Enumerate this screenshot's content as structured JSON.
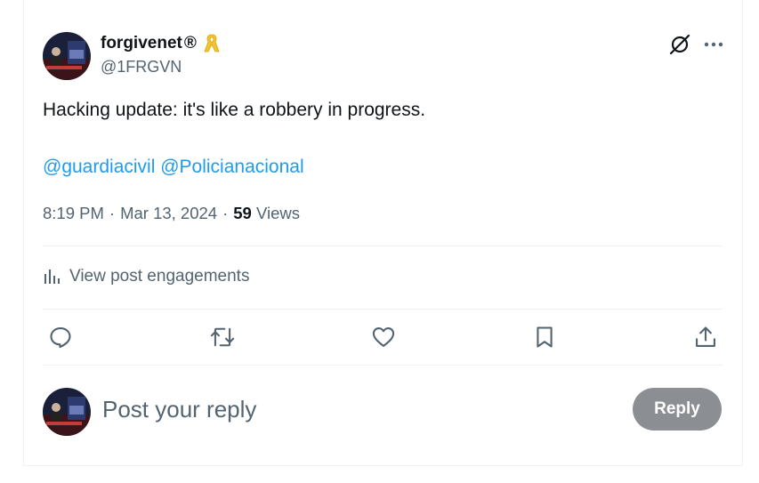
{
  "author": {
    "display_name": "forgivenet",
    "registered_mark": "®",
    "badge_icon": "yellow-ribbon-icon",
    "handle": "@1FRGVN"
  },
  "tweet": {
    "text": "Hacking update: it's like a robbery in progress.",
    "mentions": [
      "@guardiacivil",
      "@Policianacional"
    ],
    "time": "8:19 PM",
    "date": "Mar 13, 2024",
    "views_count": "59",
    "views_label": "Views"
  },
  "engagements": {
    "label": "View post engagements"
  },
  "actions": [
    "reply-icon",
    "repost-icon",
    "like-icon",
    "bookmark-icon",
    "share-icon"
  ],
  "compose": {
    "placeholder": "Post your reply",
    "button_label": "Reply"
  },
  "colors": {
    "link": "#1d9bf0",
    "muted": "#536471",
    "text": "#0f1419",
    "reply_button": "#8b8f93",
    "ribbon": "#f4c430"
  }
}
